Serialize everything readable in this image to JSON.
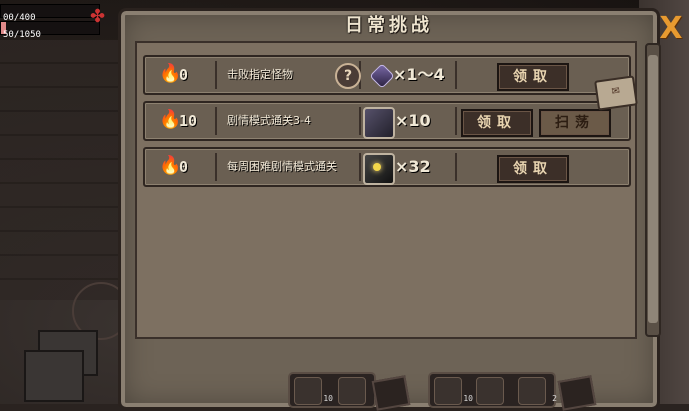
{
  "hud": {
    "hp_text": "00/400",
    "mp_text": "50/1050",
    "hp_ratio": 0.0,
    "mp_ratio": 0.05
  },
  "panel": {
    "title": "日常挑战",
    "close_label": "X"
  },
  "tasks": [
    {
      "count": "0",
      "description": "击败指定怪物",
      "reward_icons": [
        "question-icon",
        "crystal-icon"
      ],
      "reward_qty": "×1～4",
      "buttons": [
        "领取"
      ]
    },
    {
      "count": "10",
      "description": "剧情模式通关3-4",
      "reward_icons": [
        "book-icon"
      ],
      "reward_qty": "×10",
      "buttons": [
        "领取",
        "扫荡"
      ]
    },
    {
      "count": "0",
      "description": "每周困难剧情模式通关",
      "reward_icons": [
        "box-icon"
      ],
      "reward_qty": "×32",
      "buttons": [
        "领取"
      ]
    }
  ],
  "toolbar": {
    "left_count": "10",
    "right_counts": [
      "10",
      "2"
    ]
  },
  "colors": {
    "accent": "#e79a30",
    "hp": "#9b1d1d",
    "panel_bg": "#6d6356"
  }
}
